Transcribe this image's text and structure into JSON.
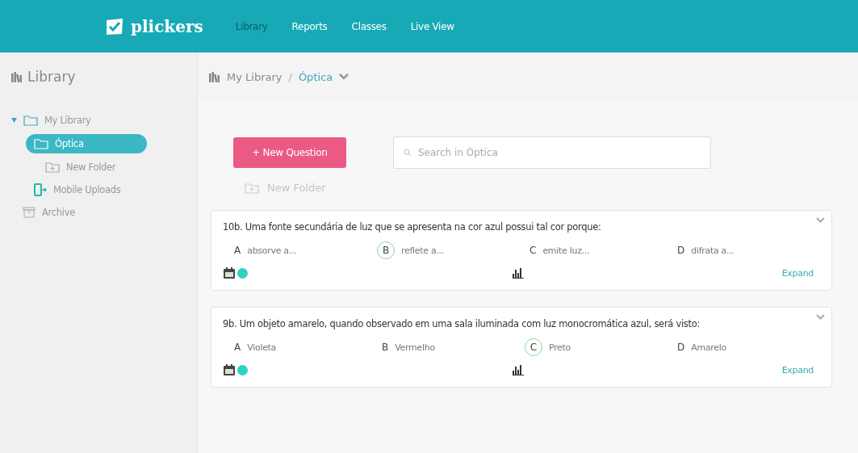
{
  "brand": {
    "name": "plickers"
  },
  "nav": [
    {
      "label": "Library",
      "selected": true
    },
    {
      "label": "Reports",
      "selected": false
    },
    {
      "label": "Classes",
      "selected": false
    },
    {
      "label": "Live View",
      "selected": false
    }
  ],
  "sidebar": {
    "title": "Library",
    "items": [
      {
        "label": "My Library",
        "kind": "folder",
        "selected": false,
        "expanded": true,
        "children": [
          {
            "label": "Óptica",
            "kind": "folder",
            "selected": true,
            "children": [
              {
                "label": "New Folder",
                "kind": "new-folder",
                "selected": false
              }
            ]
          },
          {
            "label": "Mobile Uploads",
            "kind": "mobile",
            "selected": false
          }
        ]
      },
      {
        "label": "Archive",
        "kind": "archive",
        "selected": false
      }
    ]
  },
  "breadcrumb": {
    "root": "My Library",
    "separator": "/",
    "current": "Óptica"
  },
  "new_question_button": "+ New Question",
  "search": {
    "placeholder": "Search in Óptica"
  },
  "new_folder": "New Folder",
  "questions": [
    {
      "title": "10b. Uma fonte secundária de luz que se apresenta na cor azul possui tal cor porque:",
      "color": "#2fd2c0",
      "expand": "Expand",
      "answers": [
        {
          "letter": "A",
          "text": "absorve a...",
          "correct": false
        },
        {
          "letter": "B",
          "text": "reflete a...",
          "correct": true
        },
        {
          "letter": "C",
          "text": "emite luz...",
          "correct": false
        },
        {
          "letter": "D",
          "text": "difrata a...",
          "correct": false
        }
      ]
    },
    {
      "title": "9b. Um objeto amarelo, quando observado em uma sala iluminada com luz monocromática azul, será visto:",
      "color": "#2fd2c0",
      "expand": "Expand",
      "answers": [
        {
          "letter": "A",
          "text": "Violeta",
          "correct": false
        },
        {
          "letter": "B",
          "text": "Vermelho",
          "correct": false
        },
        {
          "letter": "C",
          "text": "Preto",
          "correct": true
        },
        {
          "letter": "D",
          "text": "Amarelo",
          "correct": false
        }
      ]
    }
  ]
}
